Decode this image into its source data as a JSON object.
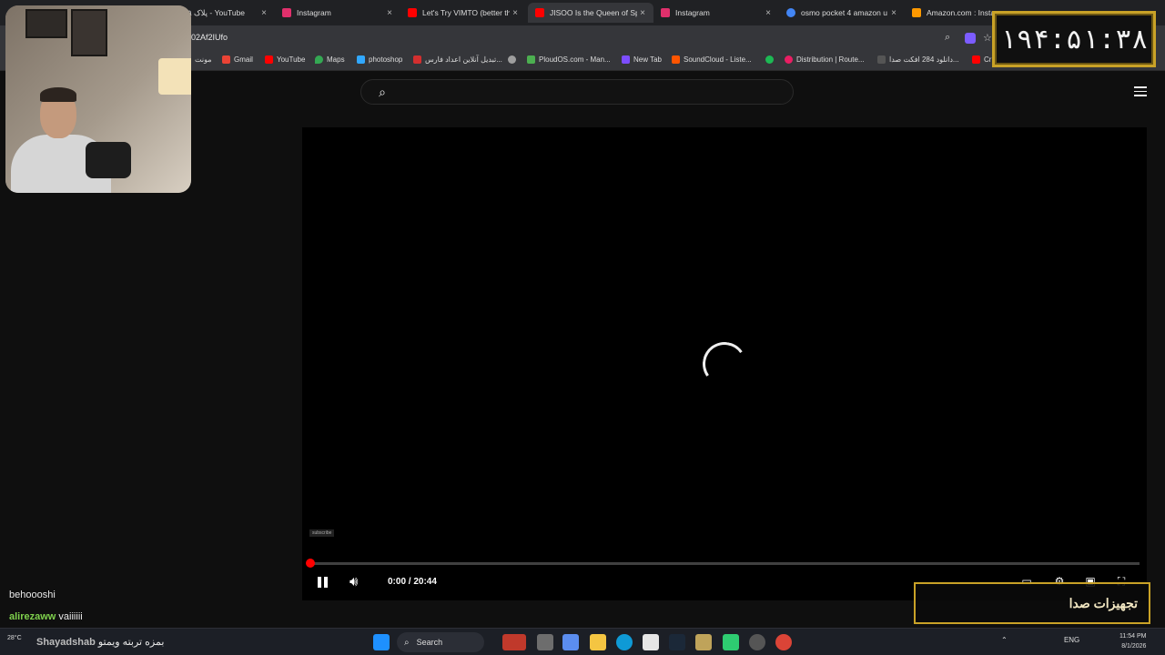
{
  "browser": {
    "tabs": [
      {
        "title": "k9 / پلاک ۹ - YouTube",
        "favicon_color": "#ff0000",
        "active": false
      },
      {
        "title": "Instagram",
        "favicon_color": "#e1306c",
        "active": false
      },
      {
        "title": "Let's Try VIMTO (better th",
        "favicon_color": "#ff0000",
        "active": false
      },
      {
        "title": "JISOO Is the Queen of Sp",
        "favicon_color": "#ff0000",
        "active": true
      },
      {
        "title": "Instagram",
        "favicon_color": "#e1306c",
        "active": false
      },
      {
        "title": "osmo pocket 4 amazon u",
        "favicon_color": "#4285f4",
        "active": false
      },
      {
        "title": "Amazon.com : Insta360",
        "favicon_color": "#ff9900",
        "active": false
      }
    ],
    "close_glyph": "×",
    "url": "02Af2IUfo",
    "bookmarks": [
      {
        "label": "مونت",
        "color": "#888888"
      },
      {
        "label": "Gmail",
        "color": "#ea4335"
      },
      {
        "label": "YouTube",
        "color": "#ff0000"
      },
      {
        "label": "Maps",
        "color": "#34a853"
      },
      {
        "label": "photoshop",
        "color": "#31a8ff"
      },
      {
        "label": "تبدیل آنلاین اعداد فارس...",
        "color": "#d32f2f"
      },
      {
        "label": "",
        "color": "#9e9e9e"
      },
      {
        "label": "PloudOS.com - Man...",
        "color": "#4caf50"
      },
      {
        "label": "New Tab",
        "color": "#7c4dff"
      },
      {
        "label": "SoundCloud - Liste...",
        "color": "#ff5500"
      },
      {
        "label": "",
        "color": "#1db954"
      },
      {
        "label": "Distribution | Route...",
        "color": "#e91e63"
      },
      {
        "label": "دانلود 284 افکت صدا...",
        "color": "#555555"
      },
      {
        "label": "Cr",
        "color": "#ff0000"
      }
    ]
  },
  "youtube": {
    "player": {
      "current_time": "0:00",
      "duration": "20:44",
      "time_display": "0:00 / 20:44",
      "progress_fraction": 0.0,
      "watermark": "subscribe",
      "state": "loading"
    }
  },
  "overlays": {
    "clock": "۱۹۴:۵۱:۳۸",
    "sound_effects_label": "تجهیزات صدا",
    "chat": [
      {
        "user": "",
        "message": "behoooshi"
      },
      {
        "user": "alirezaww",
        "message": "vaiiiiii"
      },
      {
        "user": "Shayadshab",
        "message": "بمزه تربته ويمتو"
      }
    ]
  },
  "taskbar": {
    "search_label": "Search",
    "weather": "28°C",
    "tray_language": "ENG",
    "time": "11:54 PM",
    "date": "8/1/2026"
  },
  "colors": {
    "accent_red": "#ff0000",
    "overlay_gold": "#c9a227",
    "chat_user_green": "#7fd14d"
  }
}
